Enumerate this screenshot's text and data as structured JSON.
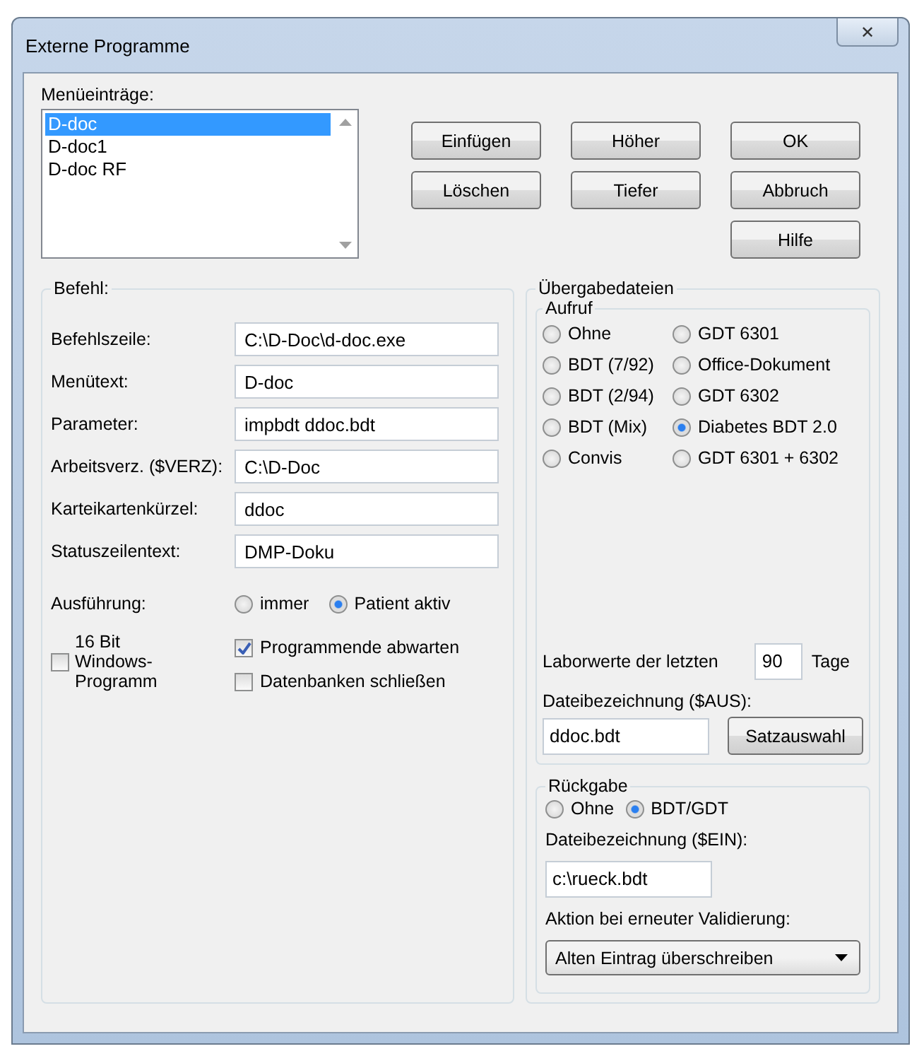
{
  "window": {
    "title": "Externe Programme",
    "close_label": "✕"
  },
  "menu_entries": {
    "label": "Menüeinträge:",
    "items": [
      {
        "text": "D-doc",
        "selected": true
      },
      {
        "text": "D-doc1",
        "selected": false
      },
      {
        "text": "D-doc RF",
        "selected": false
      }
    ]
  },
  "buttons": [
    {
      "label": "Einfügen"
    },
    {
      "label": "Höher"
    },
    {
      "label": "OK"
    },
    {
      "label": "Löschen"
    },
    {
      "label": "Tiefer"
    },
    {
      "label": "Abbruch"
    },
    {
      "label": "Hilfe"
    }
  ],
  "befehl": {
    "title": "Befehl:",
    "fields": [
      {
        "label": "Befehlszeile:",
        "value": "C:\\D-Doc\\d-doc.exe"
      },
      {
        "label": "Menütext:",
        "value": "D-doc"
      },
      {
        "label": "Parameter:",
        "value": "impbdt ddoc.bdt"
      },
      {
        "label": "Arbeitsverz. ($VERZ):",
        "value": "C:\\D-Doc"
      },
      {
        "label": "Karteikartenkürzel:",
        "value": "ddoc"
      },
      {
        "label": "Statuszeilentext:",
        "value": "DMP-Doku"
      }
    ],
    "execution": {
      "label": "Ausführung:",
      "options": [
        {
          "label": "immer",
          "selected": false
        },
        {
          "label": "Patient aktiv",
          "selected": true
        }
      ]
    },
    "sixteen_bit": {
      "label": "16 Bit Windows-Programm",
      "checked": false
    },
    "checkboxes": [
      {
        "label": "Programmende abwarten",
        "checked": true
      },
      {
        "label": "Datenbanken schließen",
        "checked": false
      }
    ]
  },
  "uebergabe": {
    "title": "Übergabedateien",
    "aufruf": {
      "title": "Aufruf",
      "options": [
        {
          "label": "Ohne",
          "selected": false
        },
        {
          "label": "GDT 6301",
          "selected": false
        },
        {
          "label": "BDT (7/92)",
          "selected": false
        },
        {
          "label": "Office-Dokument",
          "selected": false
        },
        {
          "label": "BDT (2/94)",
          "selected": false
        },
        {
          "label": "GDT 6302",
          "selected": false
        },
        {
          "label": "BDT (Mix)",
          "selected": false
        },
        {
          "label": "Diabetes BDT 2.0",
          "selected": true
        },
        {
          "label": "Convis",
          "selected": false
        },
        {
          "label": "GDT 6301 + 6302",
          "selected": false
        }
      ]
    },
    "labor": {
      "label": "Laborwerte der letzten",
      "value": "90",
      "unit": "Tage"
    },
    "file_label": "Dateibezeichnung ($AUS):",
    "file_value": "ddoc.bdt",
    "select_button": "Satzauswahl"
  },
  "rueckgabe": {
    "title": "Rückgabe",
    "options": [
      {
        "label": "Ohne",
        "selected": false
      },
      {
        "label": "BDT/GDT",
        "selected": true
      }
    ],
    "file_label": "Dateibezeichnung ($EIN):",
    "file_value": "c:\\rueck.bdt",
    "action_label": "Aktion bei erneuter Validierung:",
    "action_value": "Alten Eintrag überschreiben"
  }
}
